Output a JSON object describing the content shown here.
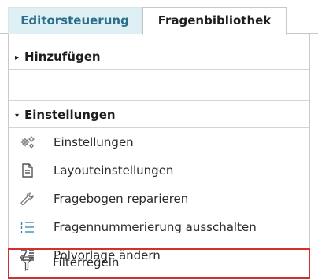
{
  "tabs": [
    {
      "label": "Editorsteuerung",
      "active": false
    },
    {
      "label": "Fragenbibliothek",
      "active": true
    }
  ],
  "sections": {
    "add": {
      "label": "Hinzufügen",
      "expanded": false,
      "caret": "▸"
    },
    "settings": {
      "label": "Einstellungen",
      "expanded": true,
      "caret": "▾"
    }
  },
  "items": [
    {
      "label": "Einstellungen",
      "icon": "gears-icon"
    },
    {
      "label": "Layouteinstellungen",
      "icon": "document-icon"
    },
    {
      "label": "Fragebogen reparieren",
      "icon": "wrench-icon"
    },
    {
      "label": "Fragennummerierung ausschalten",
      "icon": "numbered-list-icon"
    },
    {
      "label": "Polvorlage ändern",
      "icon": "swap-list-icon"
    },
    {
      "label": "Filterregeln",
      "icon": "filter-icon",
      "highlighted": true
    }
  ],
  "colors": {
    "tab_inactive_bg": "#dff0f4",
    "tab_inactive_text": "#2a6e8b",
    "icon_blue": "#2f7fb0",
    "highlight_border": "#d0302f"
  }
}
